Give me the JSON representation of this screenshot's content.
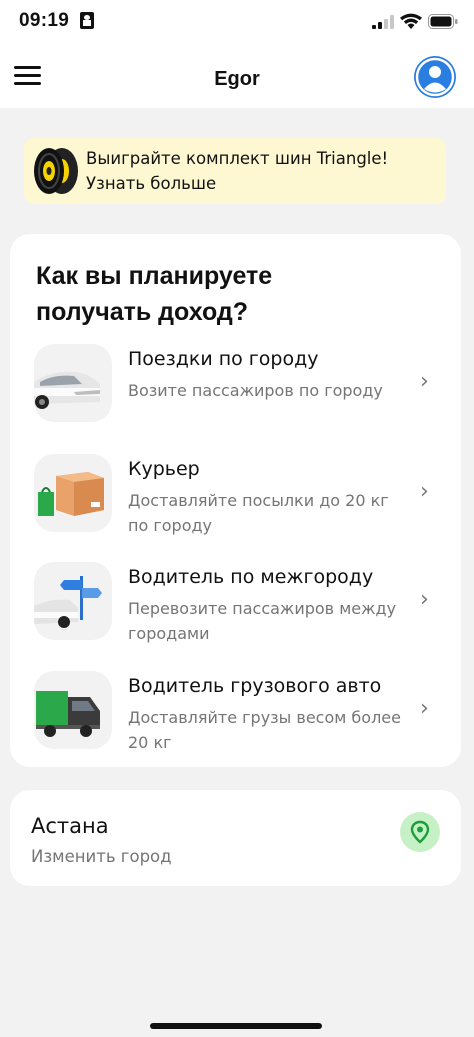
{
  "status_bar": {
    "time": "09:19"
  },
  "header": {
    "title": "Egor"
  },
  "promo": {
    "line1": "Выиграйте комплект шин Triangle!",
    "line2": "Узнать больше"
  },
  "income": {
    "title": "Как вы планируете получать доход?",
    "options": [
      {
        "title": "Поездки по городу",
        "subtitle": "Возите пассажиров по городу",
        "icon": "sedan-car-icon"
      },
      {
        "title": "Курьер",
        "subtitle": "Доставляйте посылки до 20 кг по городу",
        "icon": "parcel-box-icon"
      },
      {
        "title": "Водитель по межгороду",
        "subtitle": "Перевозите пассажиров между городами",
        "icon": "intercity-car-signpost-icon"
      },
      {
        "title": "Водитель грузового авто",
        "subtitle": "Доставляйте грузы весом более 20 кг",
        "icon": "cargo-truck-icon"
      }
    ],
    "chevron": "›"
  },
  "city": {
    "name": "Астана",
    "change_label": "Изменить город"
  },
  "colors": {
    "accent_blue": "#2a7de1",
    "promo_bg": "#fdf8d2",
    "pin_bg": "#c6f0c6",
    "pin_green": "#1e9e3a"
  }
}
